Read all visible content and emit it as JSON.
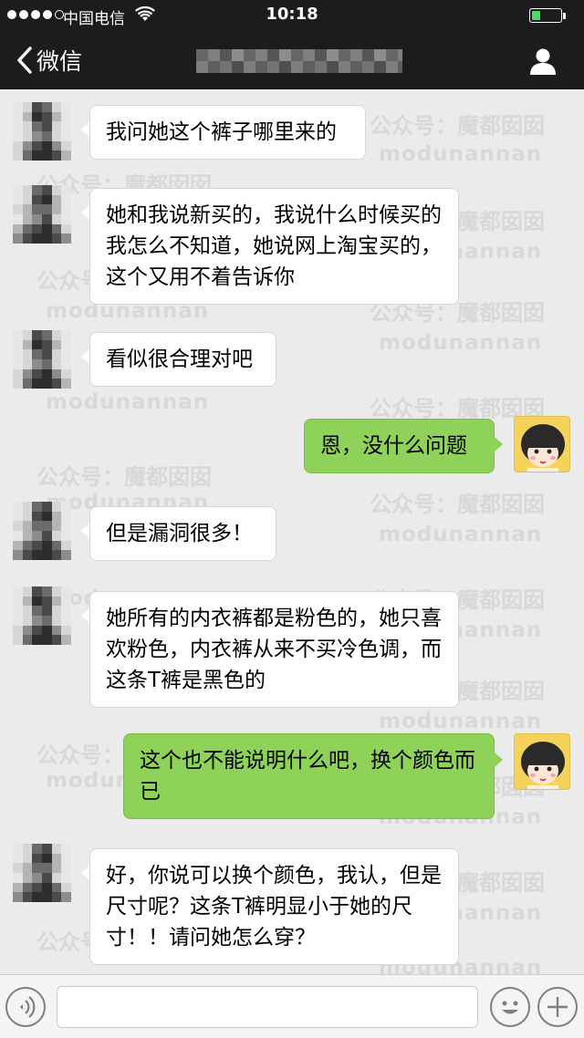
{
  "status_bar": {
    "carrier": "中国电信",
    "time": "10:18",
    "battery_level": 0.3,
    "signal_bars_filled": 4,
    "signal_bars_total": 5
  },
  "nav": {
    "back_label": "微信",
    "profile_icon": "person-icon"
  },
  "watermark": {
    "cn": "公众号：魔都囡囡",
    "en": "modunannan"
  },
  "messages": [
    {
      "from": "other",
      "text": "我问她这个裤子哪里来的"
    },
    {
      "from": "other",
      "text": "她和我说新买的，我说什么时候买的我怎么不知道，她说网上淘宝买的，这个又用不着告诉你"
    },
    {
      "from": "other",
      "text": "看似很合理对吧"
    },
    {
      "from": "me",
      "text": "恩，没什么问题"
    },
    {
      "from": "other",
      "text": "但是漏洞很多！"
    },
    {
      "from": "other",
      "text": "她所有的内衣裤都是粉色的，她只喜欢粉色，内衣裤从来不买冷色调，而这条T裤是黑色的"
    },
    {
      "from": "me",
      "text": "这个也不能说明什么吧，换个颜色而已"
    },
    {
      "from": "other",
      "text": "好，你说可以换个颜色，我认，但是尺寸呢？这条T裤明显小于她的尺寸！！请问她怎么穿？"
    }
  ],
  "input_bar": {
    "voice_icon": "voice-icon",
    "emoji_icon": "emoji-icon",
    "plus_icon": "plus-icon",
    "input_value": ""
  },
  "colors": {
    "nav_bg": "#1c1c1e",
    "chat_bg": "#ebebeb",
    "bubble_in": "#ffffff",
    "bubble_out": "#8ed259"
  }
}
